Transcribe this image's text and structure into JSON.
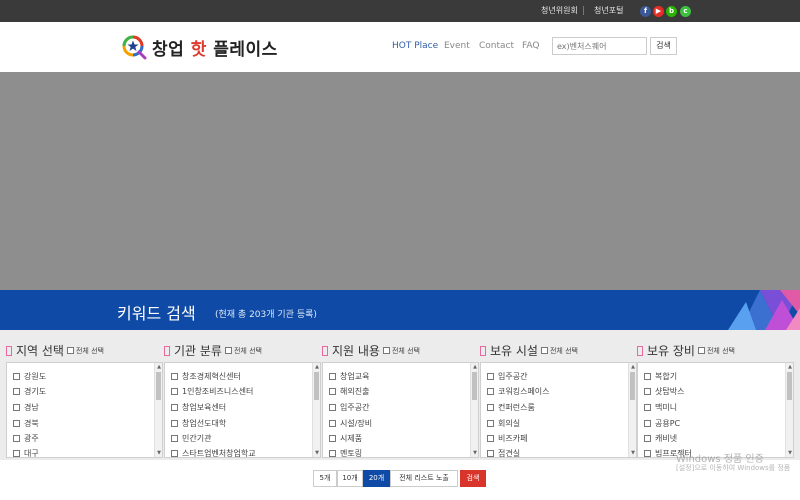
{
  "topbar": {
    "links": [
      "청년위원회",
      "청년포털"
    ],
    "social": [
      {
        "icon": "facebook-icon",
        "glyph": "f",
        "color": "#3b5998"
      },
      {
        "icon": "youtube-icon",
        "glyph": "▶",
        "color": "#e52d27"
      },
      {
        "icon": "blog-icon",
        "glyph": "b",
        "color": "#2db400"
      },
      {
        "icon": "cafe-icon",
        "glyph": "c",
        "color": "#3fbf3f"
      }
    ]
  },
  "header": {
    "logo_prefix": "창업",
    "logo_hot": "핫",
    "logo_suffix": "플레이스",
    "nav": [
      "HOT Place",
      "Event",
      "Contact",
      "FAQ"
    ],
    "search_placeholder": "ex)벤처스퀘어",
    "search_button": "검색"
  },
  "keyword": {
    "title": "키워드 검색",
    "subtitle": "(현재 총 203개 기관 등록)"
  },
  "select_all_label": "전체 선택",
  "filters": [
    {
      "title": "지역 선택",
      "items": [
        "강원도",
        "경기도",
        "경남",
        "경북",
        "광주",
        "대구"
      ]
    },
    {
      "title": "기관 분류",
      "items": [
        "창조경제혁신센터",
        "1인창조비즈니스센터",
        "창업보육센터",
        "창업선도대학",
        "민간기관",
        "스타트업벤처창업학교"
      ]
    },
    {
      "title": "지원 내용",
      "items": [
        "창업교육",
        "해외진출",
        "입주공간",
        "시설/장비",
        "시제품",
        "멘토링"
      ]
    },
    {
      "title": "보유 시설",
      "items": [
        "입주공간",
        "코워킹스페이스",
        "컨퍼런스룸",
        "회의실",
        "비즈카페",
        "접견실"
      ]
    },
    {
      "title": "보유 장비",
      "items": [
        "복합기",
        "샷탑박스",
        "맥미니",
        "공용PC",
        "캐비넷",
        "빔프로젝터"
      ]
    }
  ],
  "pager": {
    "sizes": [
      "5개",
      "10개",
      "20개"
    ],
    "selected": "20개",
    "show_all": "전체 리스트 노출",
    "search": "검색"
  },
  "watermark": {
    "title": "Windows 정품 인증",
    "subtitle": "[설정]으로 이동하여 Windows를 정품"
  },
  "colors": {
    "topbar": "#3a3a3a",
    "brand_blue": "#0e4aa6",
    "accent_red": "#d9342c",
    "banner_gray": "#8e8e8e"
  }
}
